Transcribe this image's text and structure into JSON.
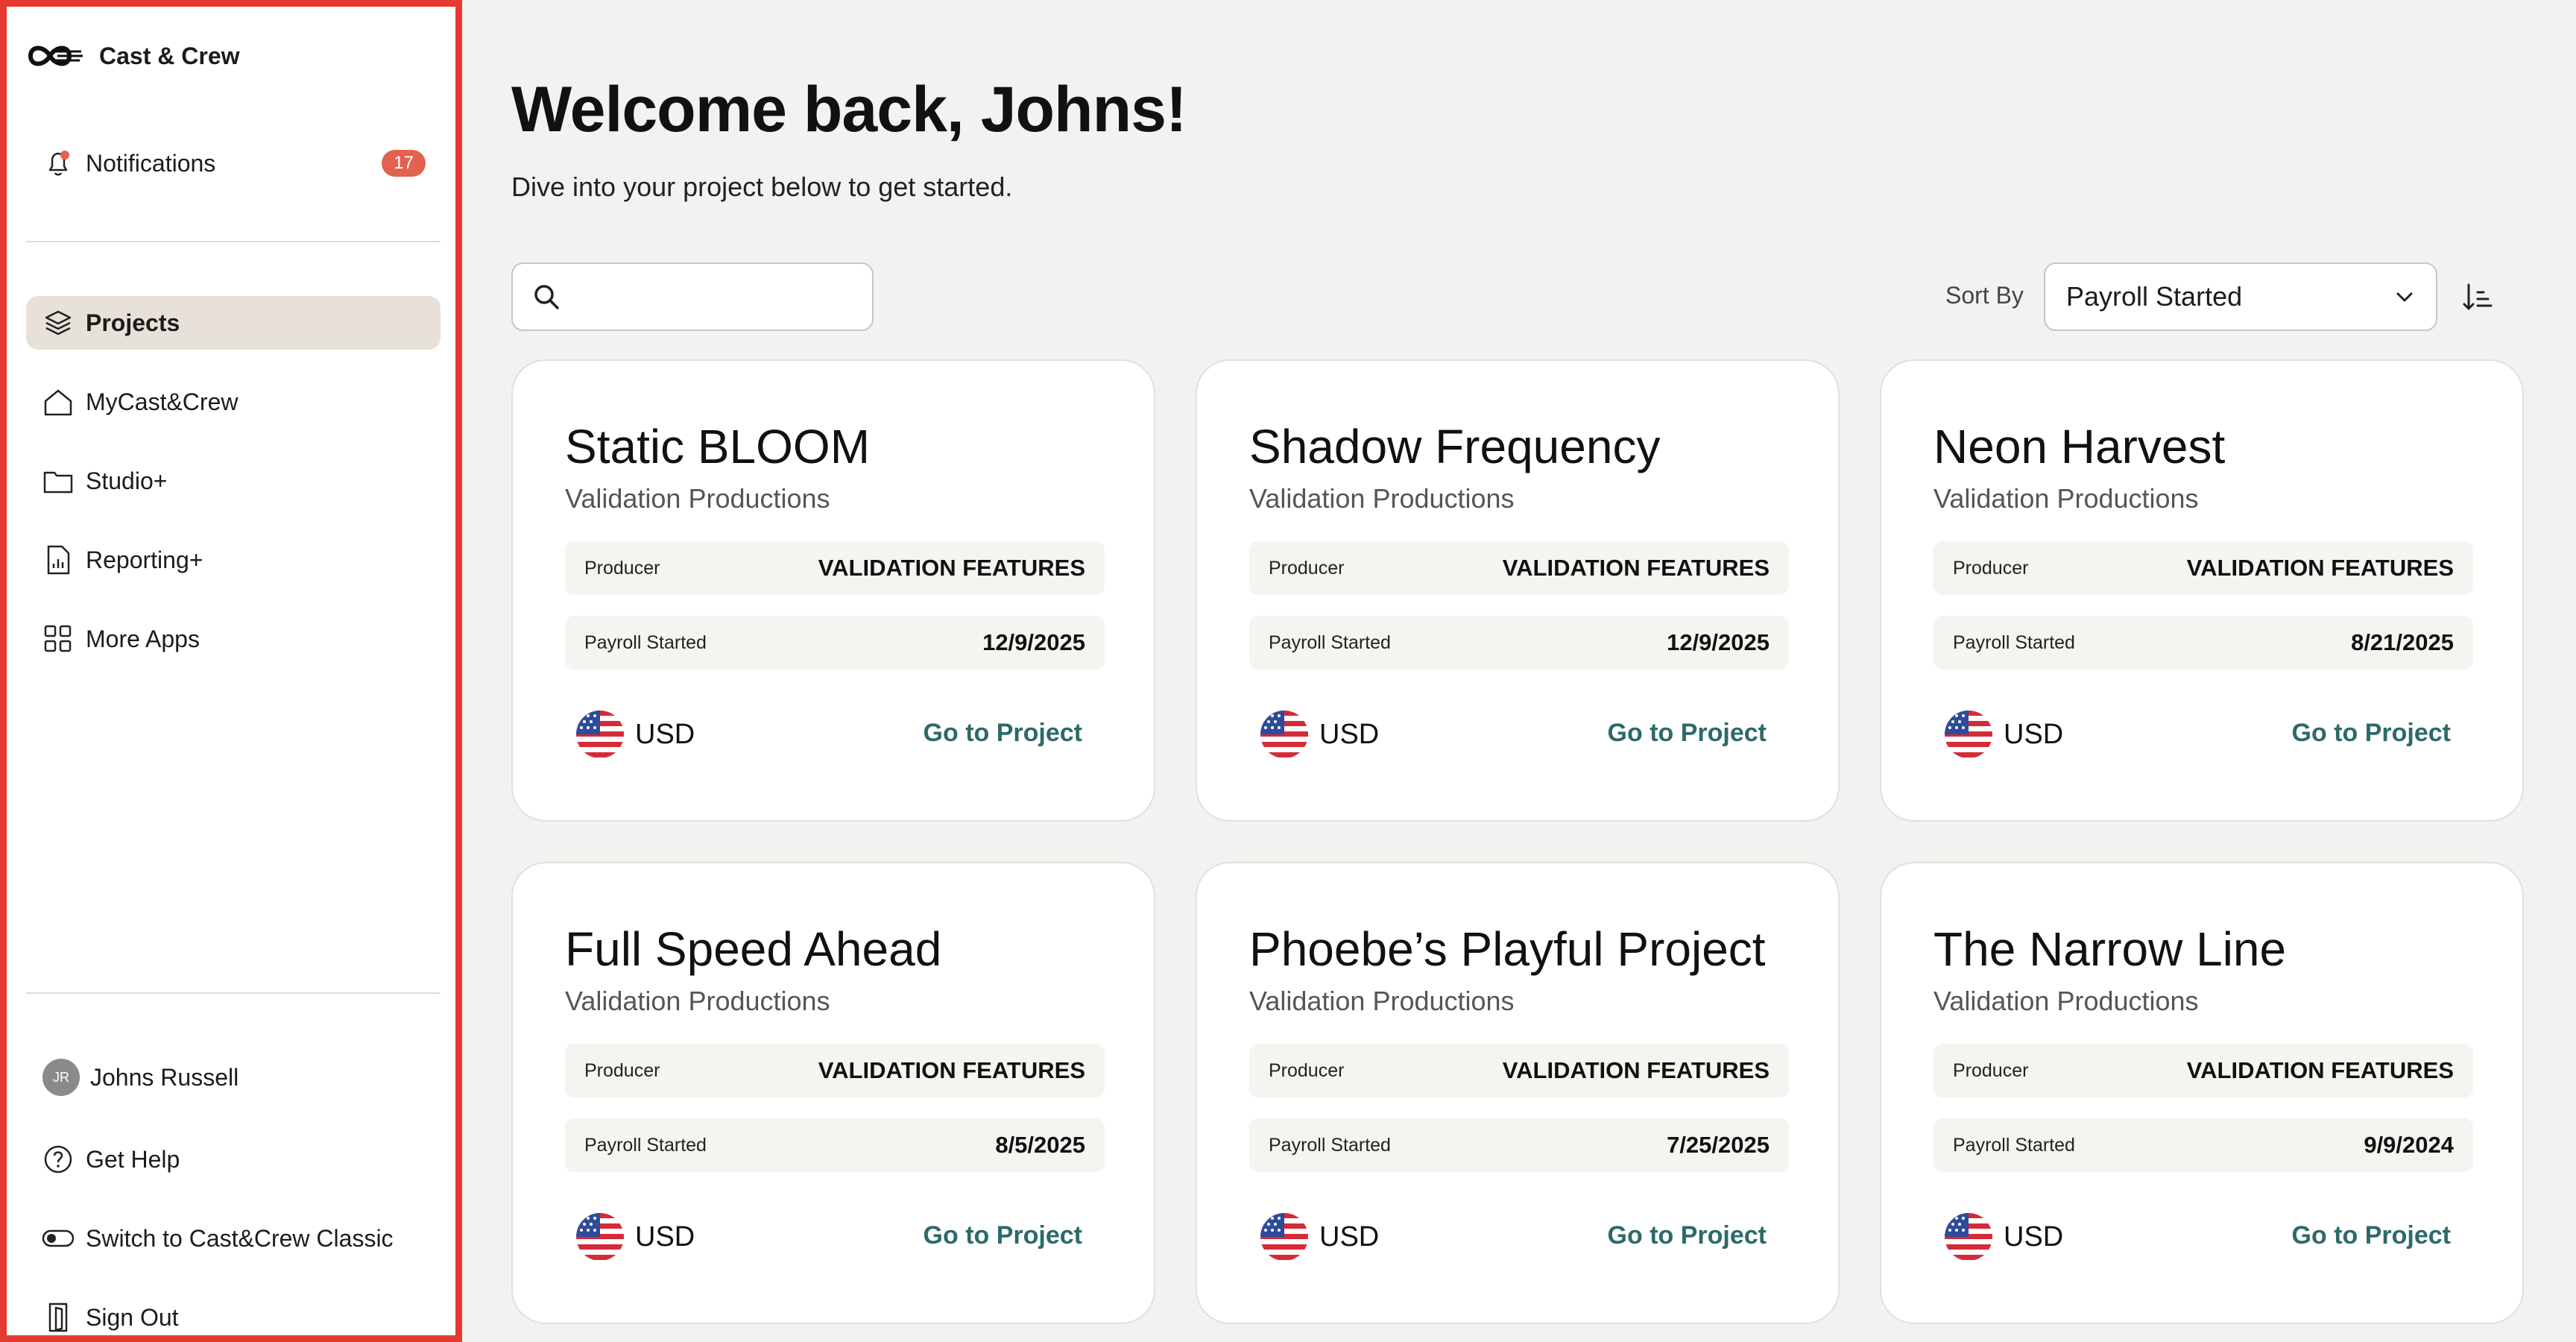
{
  "app": {
    "brand_name": "Cast & Crew",
    "accent_color": "#e53a2f",
    "link_color": "#2d6a6a"
  },
  "sidebar": {
    "notifications": {
      "label": "Notifications",
      "count": "17",
      "icon": "bell-icon"
    },
    "items": [
      {
        "label": "Projects",
        "icon": "layers-icon",
        "active": true
      },
      {
        "label": "MyCast&Crew",
        "icon": "home-icon"
      },
      {
        "label": "Studio+",
        "icon": "folder-icon"
      },
      {
        "label": "Reporting+",
        "icon": "report-icon"
      },
      {
        "label": "More Apps",
        "icon": "grid-icon"
      }
    ],
    "footer": {
      "user_initials": "JR",
      "user_name": "Johns Russell",
      "help": "Get Help",
      "switch": "Switch to Cast&Crew Classic",
      "sign_out": "Sign Out"
    }
  },
  "main": {
    "headline": "Welcome back, Johns!",
    "subhead": "Dive into your project below to get started.",
    "search": {
      "placeholder": "",
      "value": ""
    },
    "sort": {
      "label": "Sort By",
      "selected": "Payroll Started"
    },
    "card_labels": {
      "producer": "Producer",
      "payroll": "Payroll Started",
      "link": "Go to Project"
    },
    "projects": [
      {
        "title": "Static BLOOM",
        "company": "Validation Productions",
        "producer": "VALIDATION FEATURES",
        "payroll_started": "12/9/2025",
        "currency": "USD"
      },
      {
        "title": "Shadow Frequency",
        "company": "Validation Productions",
        "producer": "VALIDATION FEATURES",
        "payroll_started": "12/9/2025",
        "currency": "USD"
      },
      {
        "title": "Neon Harvest",
        "company": "Validation Productions",
        "producer": "VALIDATION FEATURES",
        "payroll_started": "8/21/2025",
        "currency": "USD"
      },
      {
        "title": "Full Speed Ahead",
        "company": "Validation Productions",
        "producer": "VALIDATION FEATURES",
        "payroll_started": "8/5/2025",
        "currency": "USD"
      },
      {
        "title": "Phoebe’s Playful Project",
        "company": "Validation Productions",
        "producer": "VALIDATION FEATURES",
        "payroll_started": "7/25/2025",
        "currency": "USD"
      },
      {
        "title": "The Narrow Line",
        "company": "Validation Productions",
        "producer": "VALIDATION FEATURES",
        "payroll_started": "9/9/2024",
        "currency": "USD"
      }
    ]
  }
}
